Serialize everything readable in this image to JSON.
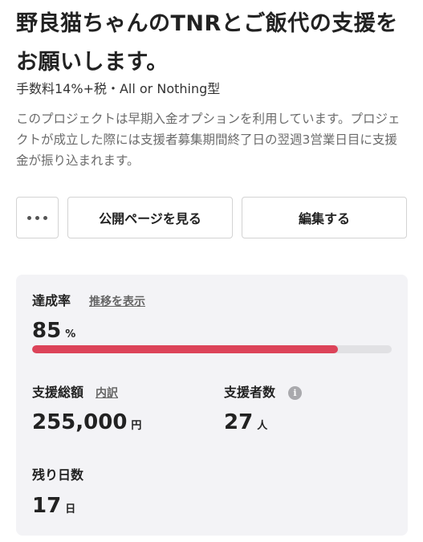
{
  "project": {
    "title": "野良猫ちゃんのTNRとご飯代の支援をお願いします。",
    "fee_info": "手数料14%+税・All or Nothing型",
    "description": "このプロジェクトは早期入金オプションを利用しています。プロジェクトが成立した際には支援者募集期間終了日の翌週3営業日目に支援金が振り込まれます。"
  },
  "actions": {
    "more_icon": "more-horizontal-icon",
    "view_public_label": "公開ページを見る",
    "edit_label": "編集する"
  },
  "stats": {
    "achievement_label": "達成率",
    "show_trend_label": "推移を表示",
    "achievement_value": "85",
    "achievement_unit": "%",
    "achievement_fraction": 0.85,
    "progress_color": "#dc4359",
    "total_label": "支援総額",
    "breakdown_label": "内訳",
    "total_value": "255,000",
    "total_unit": "円",
    "supporters_label": "支援者数",
    "supporters_info_icon": "info-icon",
    "supporters_value": "27",
    "supporters_unit": "人",
    "remaining_label": "残り日数",
    "remaining_value": "17",
    "remaining_unit": "日"
  }
}
